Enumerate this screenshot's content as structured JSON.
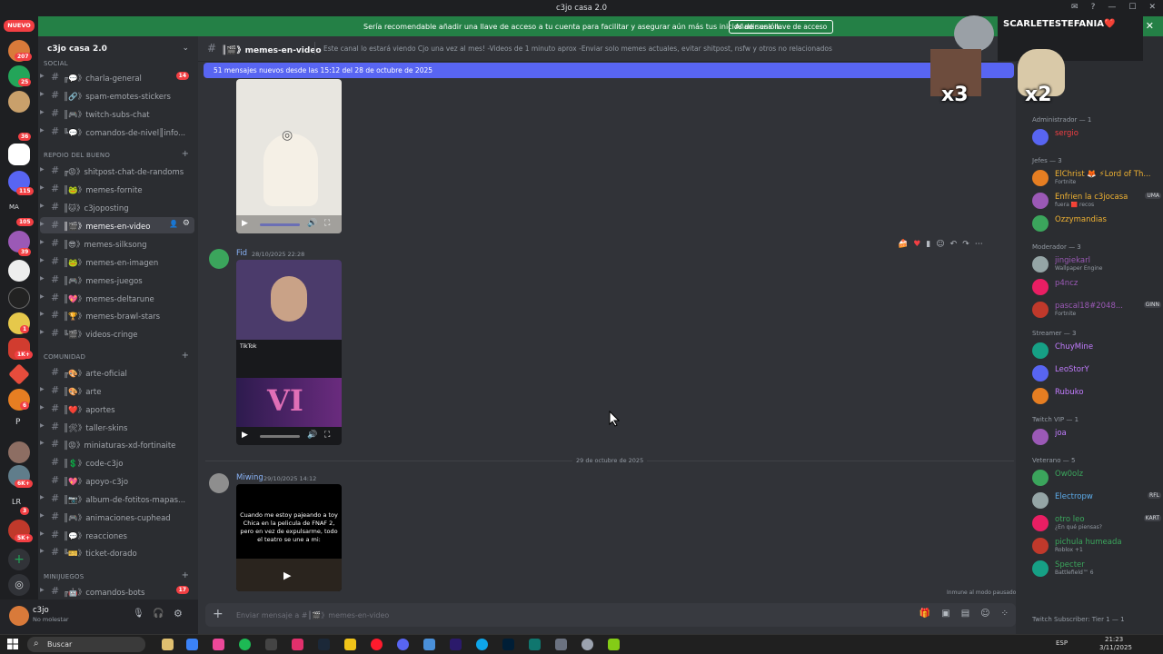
{
  "window": {
    "title": "c3jo casa 2.0"
  },
  "banner": {
    "text": "Sería recomendable añadir una llave de acceso a tu cuenta para facilitar y asegurar aún más tus inicios de sesión.",
    "button": "Añadir una llave de acceso"
  },
  "guilds": {
    "new_badge": "NUEVO",
    "badges": [
      "207",
      "25",
      "36",
      "115",
      "105",
      "39",
      "1",
      "1K+",
      "6",
      "6K+",
      "3",
      "5K+"
    ],
    "labels": [
      "MA",
      "P",
      "LR"
    ]
  },
  "server": {
    "name": "c3jo casa 2.0"
  },
  "categories": [
    {
      "name": "SOCIAL"
    },
    {
      "name": "REPOIO DEL BUENO"
    },
    {
      "name": "COMUNIDAD"
    },
    {
      "name": "MINIJUEGOS"
    }
  ],
  "channels": [
    {
      "label": "╔💬》charla-general",
      "badge": "14"
    },
    {
      "label": "║🔗》spam-emotes-stickers"
    },
    {
      "label": "║🎮》twitch-subs-chat"
    },
    {
      "label": "╚💬》comandos-de-nivel║info..."
    },
    {
      "label": "╔😡》shitpost-chat-de-randoms"
    },
    {
      "label": "║🐸》memes-fornite"
    },
    {
      "label": "║🐱》c3joposting"
    },
    {
      "label": "║🎬》memes-en-video"
    },
    {
      "label": "║😎》memes-silksong"
    },
    {
      "label": "║🐸》memes-en-imagen"
    },
    {
      "label": "║🎮》memes-juegos"
    },
    {
      "label": "║💖》memes-deltarune"
    },
    {
      "label": "║🏆》memes-brawl-stars"
    },
    {
      "label": "╚🎬》videos-cringe"
    },
    {
      "label": "╔🎨》arte-oficial"
    },
    {
      "label": "║🎨》arte"
    },
    {
      "label": "║❤️》aportes"
    },
    {
      "label": "║🛠》taller-skins"
    },
    {
      "label": "║😡》miniaturas-xd-fortinaite"
    },
    {
      "label": "║💲》code-c3jo"
    },
    {
      "label": "║💖》apoyo-c3jo"
    },
    {
      "label": "║📷》album-de-fotitos-mapas..."
    },
    {
      "label": "║🎮》animaciones-cuphead"
    },
    {
      "label": "║💬》reacciones"
    },
    {
      "label": "╚🎫》ticket-dorado"
    },
    {
      "label": "╔🤖》comandos-bots",
      "badge": "17"
    }
  ],
  "user": {
    "name": "c3jo",
    "status": "No molestar"
  },
  "channel_header": {
    "name": "║🎬》memes-en-video",
    "topic": "Este canal lo estará viendo Cjo una vez al mes! -Videos de 1 minuto aprox -Enviar solo memes actuales, evitar shitpost, nsfw y otros no relacionados"
  },
  "new_messages": "51 mensajes nuevos desde las 15:12 del 28 de octubre de 2025",
  "messages": [
    {
      "author": "Fid",
      "time": "28/10/2025 22:28",
      "video_text": "TikTok",
      "overlay": "VI"
    },
    {
      "author": "Miwing",
      "time": "29/10/2025 14:12",
      "video_text": "Cuando me estoy pajeando a toy Chica en la pelicula de FNAF 2, pero en vez de expulsarme, todo el teatro se une a mi:"
    }
  ],
  "date_divider": "29 de octubre de 2025",
  "input_placeholder": "Enviar mensaje a #║🎬》memes-en-video",
  "immune_note": "Inmune al modo pausado",
  "overlay": {
    "streamer": "SCARLETESTEFANIA❤️",
    "x3": "x3",
    "x2": "x2"
  },
  "members": {
    "groups": [
      {
        "title": "Administrador — 1",
        "items": [
          {
            "name": "sergio",
            "color": "#f23f43",
            "sub": ""
          }
        ]
      },
      {
        "title": "Jefes — 3",
        "items": [
          {
            "name": "ElChrist 🦊 ⚡Lord of Th...",
            "color": "#f0b232",
            "sub": "Fortnite"
          },
          {
            "name": "Enfrien la c3jocasa",
            "color": "#f0b232",
            "sub": "fuera 🟥 recos",
            "tag": "UMA"
          },
          {
            "name": "Ozzymandias",
            "color": "#f0b232",
            "sub": ""
          }
        ]
      },
      {
        "title": "Moderador — 3",
        "items": [
          {
            "name": "jingiekarl",
            "color": "#9b59b6",
            "sub": "Wallpaper Engine"
          },
          {
            "name": "p4ncz",
            "color": "#9b59b6",
            "sub": ""
          },
          {
            "name": "pascal18#2048...",
            "color": "#9b59b6",
            "sub": "Fortnite",
            "tag": "GINN"
          }
        ]
      },
      {
        "title": "Streamer — 3",
        "items": [
          {
            "name": "ChuyMine",
            "color": "#c27cff",
            "sub": ""
          },
          {
            "name": "LeoStorY",
            "color": "#c27cff",
            "sub": ""
          },
          {
            "name": "Rubuko",
            "color": "#c27cff",
            "sub": ""
          }
        ]
      },
      {
        "title": "Twitch VIP — 1",
        "items": [
          {
            "name": "joa",
            "color": "#c27cff",
            "sub": ""
          }
        ]
      },
      {
        "title": "Veterano — 5",
        "items": [
          {
            "name": "Ow0olz",
            "color": "#3ba55c",
            "sub": ""
          },
          {
            "name": "Electropw",
            "color": "#5dadec",
            "sub": "",
            "tag": "RFL"
          },
          {
            "name": "otro leo",
            "color": "#3ba55c",
            "sub": "¿En qué piensas?",
            "tag": "KART"
          },
          {
            "name": "pichula humeada",
            "color": "#3ba55c",
            "sub": "Roblox +1"
          },
          {
            "name": "Specter",
            "color": "#3ba55c",
            "sub": "Battlefield™ 6"
          }
        ]
      }
    ],
    "footer": "Twitch Subscriber: Tier 1 — 1"
  },
  "taskbar": {
    "search": "Buscar",
    "lang": "ESP",
    "time": "21:23",
    "date": "3/11/2025"
  }
}
